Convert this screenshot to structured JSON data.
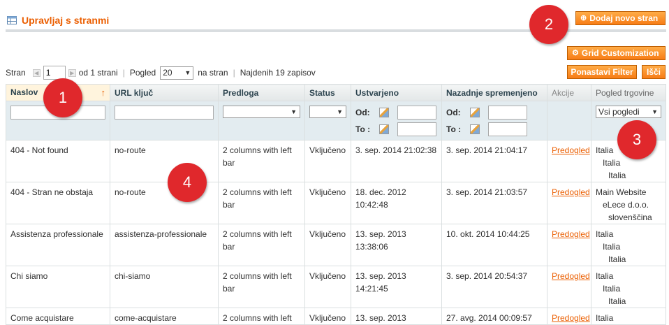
{
  "header": {
    "title": "Upravljaj s stranmi",
    "add_button": "Dodaj novo stran",
    "grid_button": "Grid Customization",
    "reset_button": "Ponastavi Filter",
    "search_button": "Išči"
  },
  "pager": {
    "page_label": "Stran",
    "page_value": "1",
    "of_pages": "od 1 strani",
    "view_label": "Pogled",
    "per_page": "20",
    "per_page_suffix": "na stran",
    "records": "Najdenih 19 zapisov"
  },
  "columns": [
    "Naslov",
    "URL ključ",
    "Predloga",
    "Status",
    "Ustvarjeno",
    "Nazadnje spremenjeno",
    "Akcije",
    "Pogled trgovine"
  ],
  "filters": {
    "from_label": "Od:",
    "to_label": "To :",
    "store_view_option": "Vsi pogledi"
  },
  "rows": [
    {
      "title": "404 - Not found",
      "url": "no-route",
      "layout": "2 columns with left bar",
      "status": "Vključeno",
      "created": "3. sep. 2014 21:02:38",
      "modified": "3. sep. 2014 21:04:17",
      "action": "Predogled",
      "stores": [
        "Italia",
        "Italia",
        "Italia"
      ]
    },
    {
      "title": "404 - Stran ne obstaja",
      "url": "no-route",
      "layout": "2 columns with left bar",
      "status": "Vključeno",
      "created": "18. dec. 2012 10:42:48",
      "modified": "3. sep. 2014 21:03:57",
      "action": "Predogled",
      "stores": [
        "Main Website",
        "eLece d.o.o.",
        "slovenščina"
      ]
    },
    {
      "title": "Assistenza professionale",
      "url": "assistenza-professionale",
      "layout": "2 columns with left bar",
      "status": "Vključeno",
      "created": "13. sep. 2013 13:38:06",
      "modified": "10. okt. 2014 10:44:25",
      "action": "Predogled",
      "stores": [
        "Italia",
        "Italia",
        "Italia"
      ]
    },
    {
      "title": "Chi siamo",
      "url": "chi-siamo",
      "layout": "2 columns with left bar",
      "status": "Vključeno",
      "created": "13. sep. 2013 14:21:45",
      "modified": "3. sep. 2014 20:54:37",
      "action": "Predogled",
      "stores": [
        "Italia",
        "Italia",
        "Italia"
      ]
    },
    {
      "title": "Come acquistare",
      "url": "come-acquistare",
      "layout": "2 columns with left",
      "status": "Vključeno",
      "created": "13. sep. 2013",
      "modified": "27. avg. 2014 00:09:57",
      "action": "Predogled",
      "stores": [
        "Italia"
      ]
    }
  ],
  "callouts": [
    "1",
    "2",
    "3",
    "4"
  ],
  "colors": {
    "accent": "#eb5e00",
    "callout": "#e0282c",
    "filter_bg": "#e3ecf0"
  }
}
